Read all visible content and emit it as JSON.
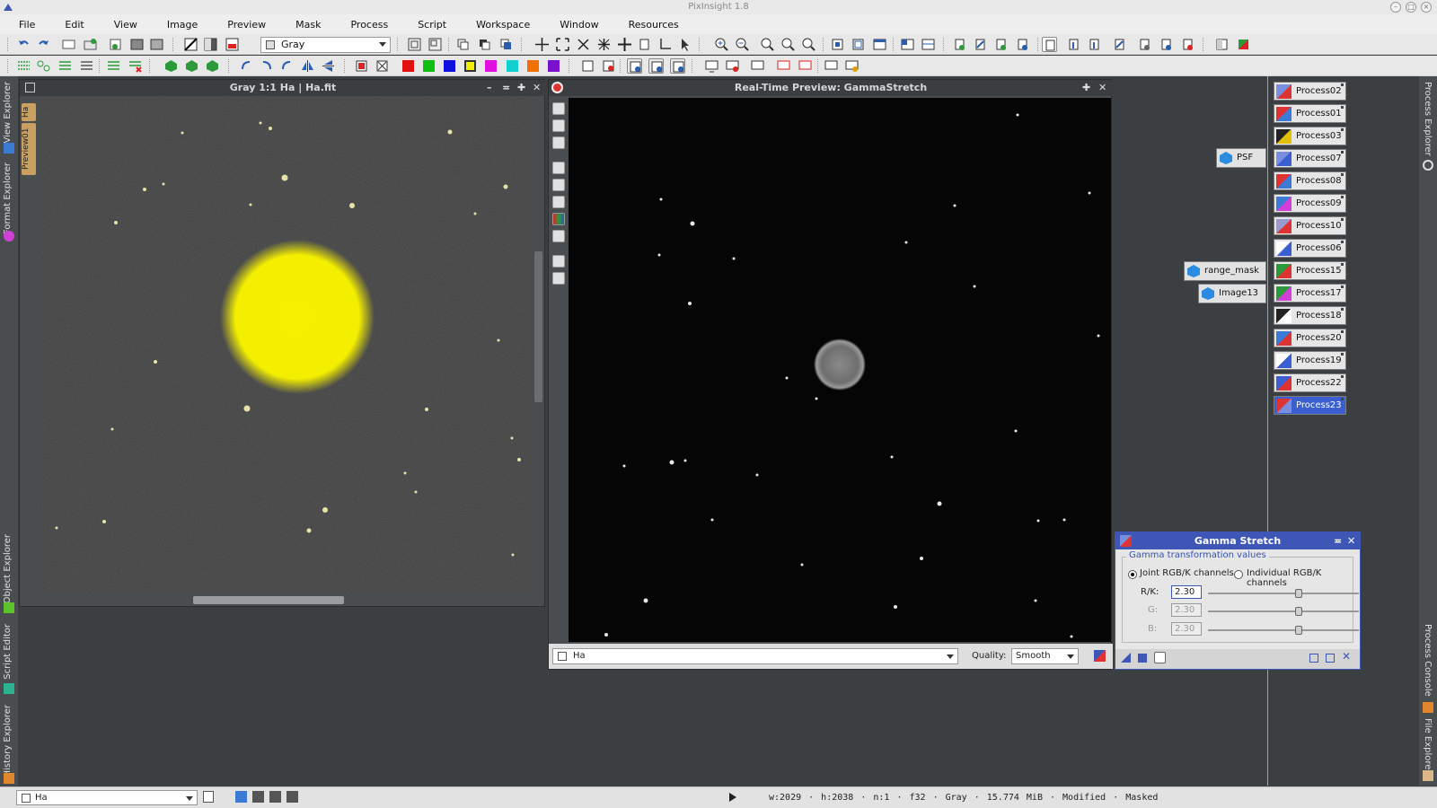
{
  "app": {
    "title": "PixInsight 1.8"
  },
  "menubar": {
    "items": [
      "File",
      "Edit",
      "View",
      "Image",
      "Preview",
      "Mask",
      "Process",
      "Script",
      "Workspace",
      "Window",
      "Resources"
    ]
  },
  "toolbar": {
    "colorspace_value": "Gray"
  },
  "left_tabs": {
    "view_explorer": "View Explorer",
    "format_explorer": "Format Explorer",
    "object_explorer": "Object Explorer",
    "script_editor": "Script Editor",
    "history_explorer": "History Explorer"
  },
  "right_tabs": {
    "process_explorer": "Process Explorer",
    "process_console": "Process Console",
    "file_explorer": "File Explorer"
  },
  "image_window": {
    "title": "Gray 1:1 Ha | Ha.fit",
    "tabs": [
      "Ha",
      "Preview01"
    ]
  },
  "preview_window": {
    "title": "Real-Time Preview: GammaStretch",
    "view_select": "Ha",
    "quality_label": "Quality:",
    "quality_value": "Smooth"
  },
  "process_icons": [
    "Process02",
    "Process01",
    "Process03",
    "Process07",
    "Process08",
    "Process09",
    "Process10",
    "Process06",
    "Process15",
    "Process17",
    "Process18",
    "Process20",
    "Process19",
    "Process22",
    "Process23"
  ],
  "selected_process": "Process23",
  "view_icons": {
    "psf": "PSF",
    "range_mask": "range_mask",
    "image13": "Image13"
  },
  "gamma_dialog": {
    "title": "Gamma Stretch",
    "group_label": "Gamma transformation values",
    "joint_label": "Joint RGB/K channels",
    "individual_label": "Individual RGB/K channels",
    "rk_label": "R/K:",
    "rk_value": "2.30",
    "g_label": "G:",
    "g_value": "2.30",
    "b_label": "B:",
    "b_value": "2.30",
    "mode": "joint"
  },
  "statusbar": {
    "view_select": "Ha",
    "info": "w:2029 · h:2038 · n:1 · f32 · Gray · 15.774 MiB · Modified · Masked"
  },
  "colors": {
    "accent": "#3e57b7",
    "mask_overlay": "#f6f100",
    "workspace": "#3c3f41"
  }
}
